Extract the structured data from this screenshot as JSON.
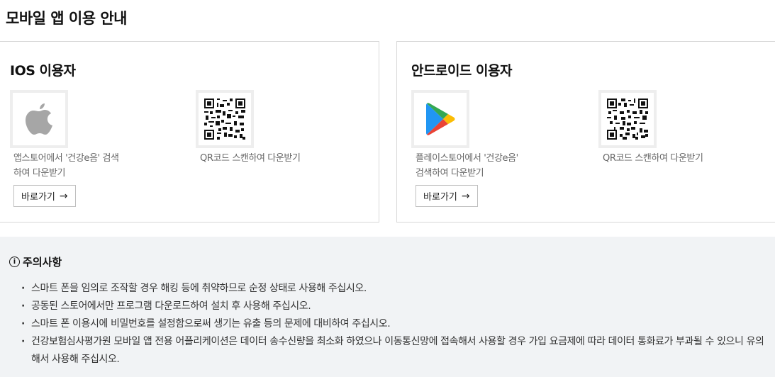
{
  "page": {
    "title": "모바일 앱 이용 안내"
  },
  "ios": {
    "title": "IOS 이용자",
    "store_desc": "앱스토어에서 '건강e음' 검색하여 다운받기",
    "qr_desc": "QR코드 스캔하여 다운받기",
    "button_label": "바로가기"
  },
  "android": {
    "title": "안드로이드 이용자",
    "store_desc": "플레이스토어에서 '건강e음' 검색하여 다운받기",
    "qr_desc": "QR코드 스캔하여 다운받기",
    "button_label": "바로가기"
  },
  "notice": {
    "title": "주의사항",
    "items": [
      "스마트 폰을 임의로 조작할 경우 해킹 등에 취약하므로 순정 상태로 사용해 주십시오.",
      "공동된 스토어에서만 프로그램 다운로드하여 설치 후 사용해 주십시오.",
      "스마트 폰 이용시에 비밀번호를 설정함으로써 생기는 유출 등의 문제에 대비하여 주십시오.",
      "건강보험심사평가원 모바일 앱 전용 어플리케이션은 데이터 송수신량을 최소화 하였으나 이동통신망에 접속해서 사용할 경우 가입 요금제에 따라 데이터 통화료가 부과될 수 있으니 유의해서 사용해 주십시오."
    ]
  },
  "icons": {
    "apple": "apple-logo-icon",
    "play": "google-play-logo-icon",
    "qr": "qr-code-icon",
    "arrow": "arrow-right-icon",
    "info": "info-icon"
  },
  "colors": {
    "apple_grey": "#a6a6a6",
    "notice_bg": "#f1f3f5",
    "border": "#d9d9d9"
  }
}
